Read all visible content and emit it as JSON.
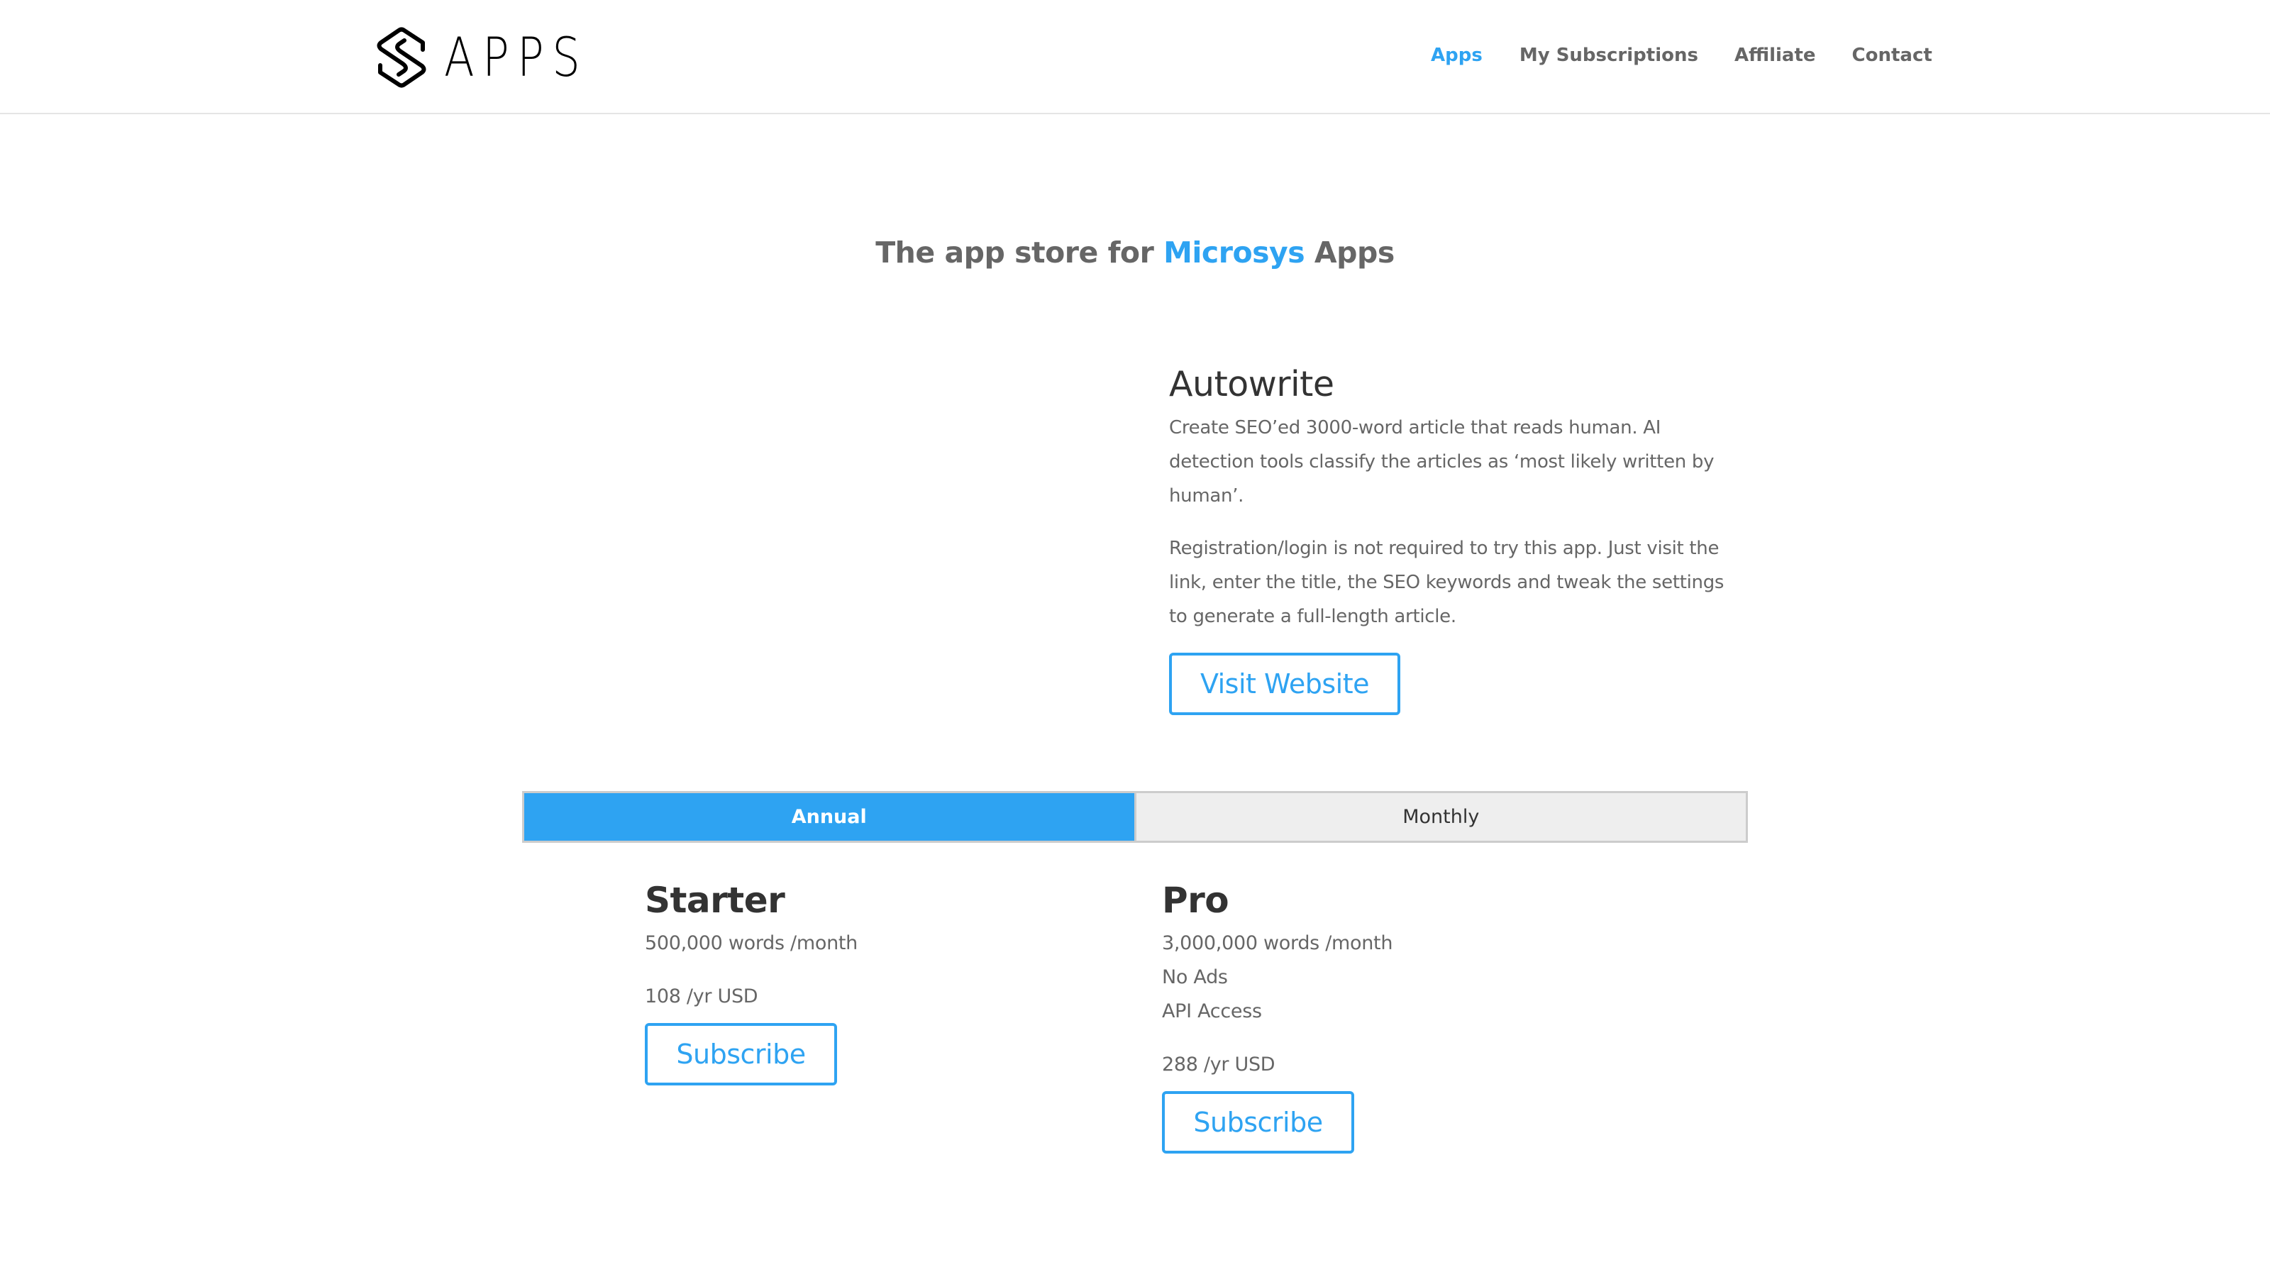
{
  "header": {
    "logo": {
      "icon": "apps-logo-icon",
      "text": "APPS"
    },
    "nav": [
      {
        "label": "Apps",
        "active": true
      },
      {
        "label": "My Subscriptions",
        "active": false
      },
      {
        "label": "Affiliate",
        "active": false
      },
      {
        "label": "Contact",
        "active": false
      }
    ]
  },
  "tagline": {
    "prefix": "The app store for ",
    "brand": "Microsys",
    "suffix": " Apps"
  },
  "app": {
    "title": "Autowrite",
    "description": [
      "Create SEO’ed 3000-word article that reads human. AI detection tools classify the articles as ‘most likely written by human’.",
      "Registration/login is not required to try this app. Just visit the link, enter the title, the SEO keywords and tweak the settings to generate a full-length article."
    ],
    "visit_button": "Visit Website"
  },
  "billing_tabs": {
    "tabs": [
      {
        "label": "Annual",
        "active": true
      },
      {
        "label": "Monthly",
        "active": false
      }
    ]
  },
  "plans": [
    {
      "name": "Starter",
      "features": [
        "500,000 words /month"
      ],
      "price": "108 /yr USD",
      "button": "Subscribe"
    },
    {
      "name": "Pro",
      "features": [
        "3,000,000 words /month",
        "No Ads",
        "API Access"
      ],
      "price": "288 /yr USD",
      "button": "Subscribe"
    }
  ],
  "colors": {
    "accent": "#2ea3f2",
    "heading": "#333333",
    "body_text": "#666666",
    "tab_inactive_bg": "#eeeeee",
    "border": "#cccccc"
  }
}
